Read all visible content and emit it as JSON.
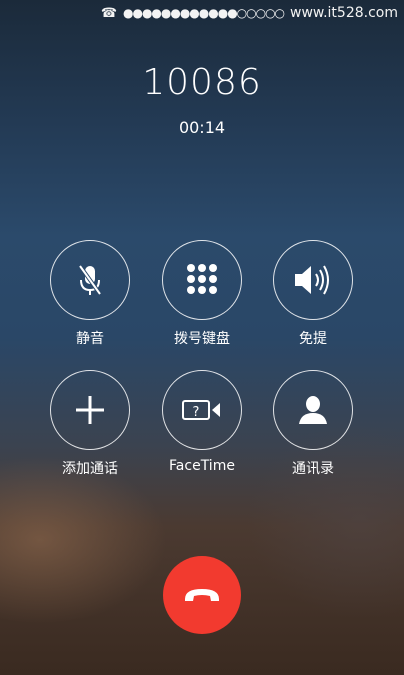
{
  "status_bar": {
    "phone_glyph": "☎",
    "signal_dots": "●●●●●●●●●●●●○○○○○",
    "site_text": "www.it528.com"
  },
  "call": {
    "number": "10086",
    "duration": "00:14"
  },
  "controls": [
    {
      "key": "mute",
      "label": "静音",
      "icon": "mic-slash-icon"
    },
    {
      "key": "keypad",
      "label": "拨号键盘",
      "icon": "keypad-icon"
    },
    {
      "key": "speaker",
      "label": "免提",
      "icon": "speaker-icon"
    },
    {
      "key": "add_call",
      "label": "添加通话",
      "icon": "plus-icon"
    },
    {
      "key": "facetime",
      "label": "FaceTime",
      "icon": "facetime-icon"
    },
    {
      "key": "contacts",
      "label": "通讯录",
      "icon": "contact-icon"
    }
  ],
  "colors": {
    "end_call": "#f23a2f",
    "button_ring": "#ffffff"
  }
}
